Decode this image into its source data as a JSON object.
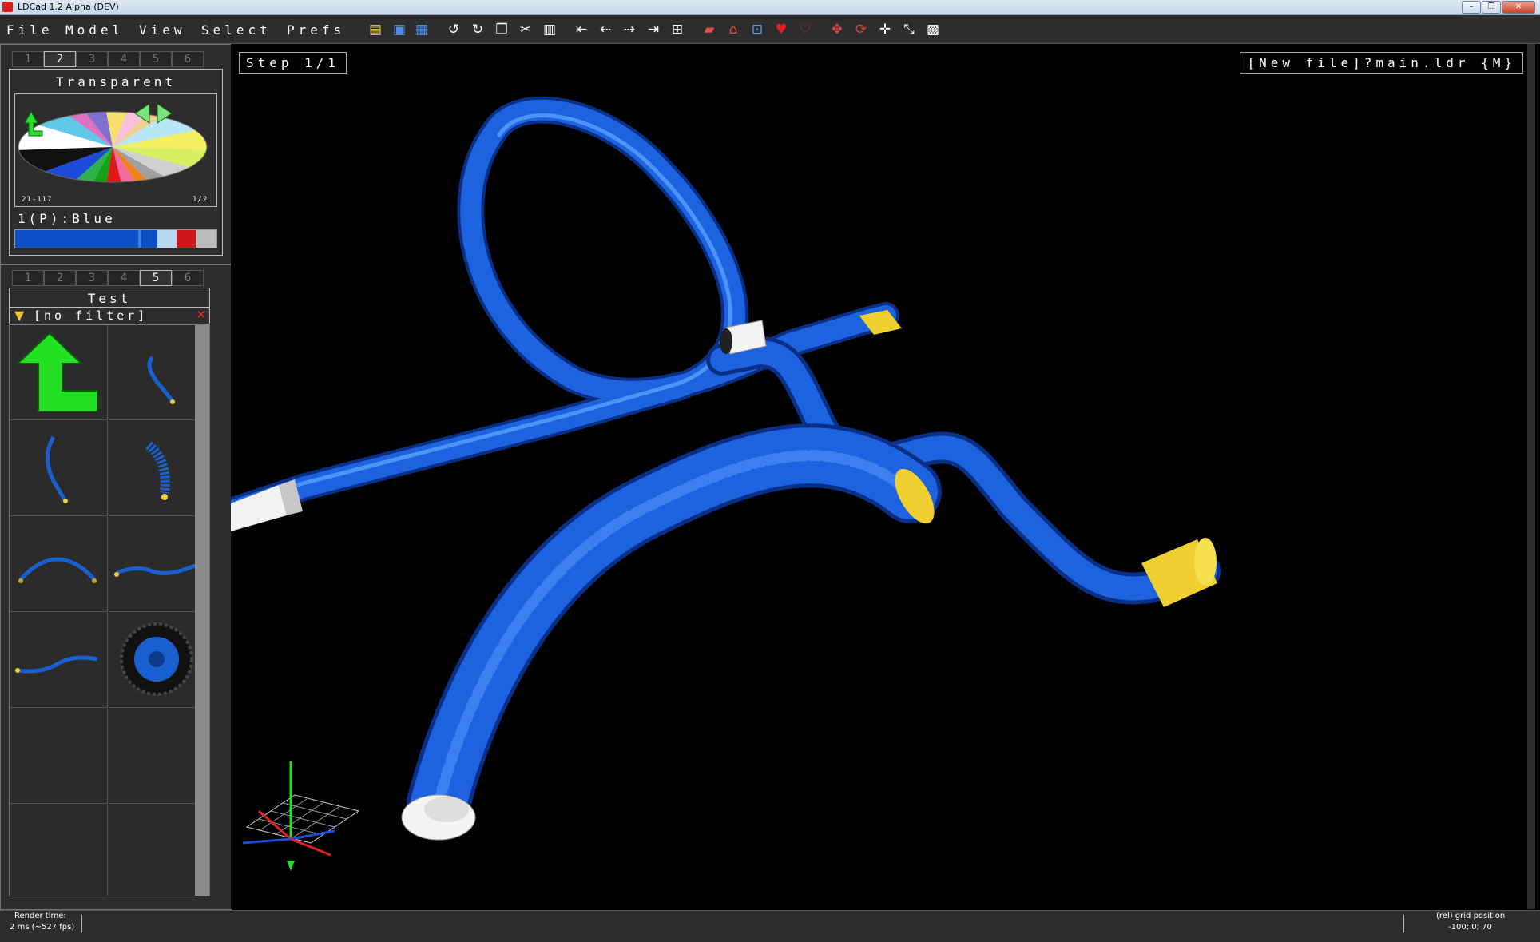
{
  "window": {
    "title": "LDCad 1.2 Alpha (DEV)",
    "min": "–",
    "max": "❐",
    "close": "✕"
  },
  "menu": [
    "File",
    "Model",
    "View",
    "Select",
    "Prefs"
  ],
  "toolbar_icons": [
    "open-icon",
    "save-icon",
    "save-all-icon",
    "undo-icon",
    "redo-icon",
    "copy-icon",
    "cut-icon",
    "paste-icon",
    "first-step-icon",
    "prev-step-icon",
    "next-step-icon",
    "last-step-icon",
    "add-step-icon",
    "brick-add-icon",
    "brick-home-icon",
    "grid-relative-icon",
    "heart-icon",
    "heart-remove-icon",
    "move-icon",
    "rotate-icon",
    "move-all-icon",
    "scale-icon",
    "grid-icon"
  ],
  "color_panel": {
    "tabs": [
      "1",
      "2",
      "3",
      "4",
      "5",
      "6"
    ],
    "active_tab": 1,
    "title": "Transparent",
    "range_label": "21-117",
    "page_label": "1/2",
    "selected_color": "1(P):Blue",
    "swatches": [
      "#0d4fc4",
      "#0d4fc4",
      "#2a76e8",
      "#b8d7f2",
      "#d01818",
      "#bbbbbb"
    ]
  },
  "parts_panel": {
    "tabs": [
      "1",
      "2",
      "3",
      "4",
      "5",
      "6"
    ],
    "active_tab": 4,
    "title": "Test",
    "filter": "[no filter]"
  },
  "viewport": {
    "step_label": "Step 1/1",
    "file_label": "[New file]?main.ldr {M}"
  },
  "status": {
    "render_label": "Render time:",
    "render_value": "2 ms (~527 fps)",
    "grid_label": "(rel) grid position",
    "grid_value": "-100; 0; 70"
  }
}
